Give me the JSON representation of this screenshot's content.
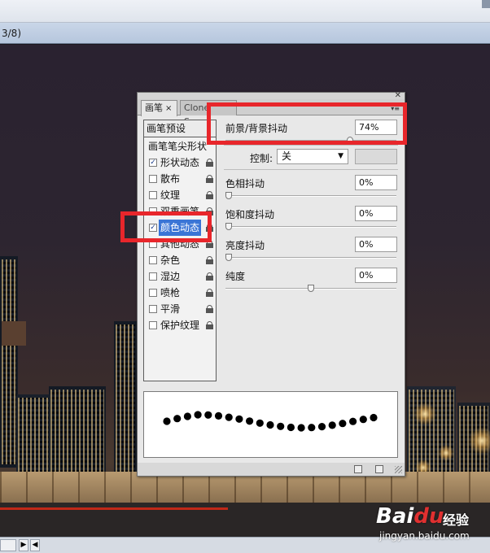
{
  "document": {
    "title_fragment": "3/8)"
  },
  "panel": {
    "tabs": [
      {
        "label": "画笔",
        "close": "×"
      },
      {
        "label": "Clone Source"
      }
    ],
    "presets_label": "画笔预设",
    "list_items": [
      {
        "label": "画笔笔尖形状",
        "checkbox": false,
        "lock": false
      },
      {
        "label": "形状动态",
        "checkbox": true,
        "checked": true,
        "lock": true
      },
      {
        "label": "散布",
        "checkbox": true,
        "checked": false,
        "lock": true
      },
      {
        "label": "纹理",
        "checkbox": true,
        "checked": false,
        "lock": true
      },
      {
        "label": "双重画笔",
        "checkbox": true,
        "checked": false,
        "lock": true
      },
      {
        "label": "颜色动态",
        "checkbox": true,
        "checked": true,
        "lock": true,
        "selected": true
      },
      {
        "label": "其他动态",
        "checkbox": true,
        "checked": false,
        "lock": true
      },
      {
        "label": "杂色",
        "checkbox": true,
        "checked": false,
        "lock": true
      },
      {
        "label": "湿边",
        "checkbox": true,
        "checked": false,
        "lock": true
      },
      {
        "label": "喷枪",
        "checkbox": true,
        "checked": false,
        "lock": true
      },
      {
        "label": "平滑",
        "checkbox": true,
        "checked": false,
        "lock": true
      },
      {
        "label": "保护纹理",
        "checkbox": true,
        "checked": false,
        "lock": true
      }
    ],
    "fg_bg_jitter": {
      "label": "前景/背景抖动",
      "value": "74%",
      "level": 0.74
    },
    "control": {
      "label": "控制:",
      "value": "关"
    },
    "hue_jitter": {
      "label": "色相抖动",
      "value": "0%",
      "level": 0
    },
    "saturation_jitter": {
      "label": "饱和度抖动",
      "value": "0%",
      "level": 0
    },
    "brightness_jitter": {
      "label": "亮度抖动",
      "value": "0%",
      "level": 0
    },
    "purity": {
      "label": "纯度",
      "value": "0%",
      "level": 0.5
    }
  },
  "watermark": {
    "brand_left": "Bai",
    "brand_mid": "du",
    "jingyan": "经验",
    "url": "jingyan.baidu.com"
  },
  "colors": {
    "annotation": "#e8262b",
    "selection": "#3a75d6"
  }
}
